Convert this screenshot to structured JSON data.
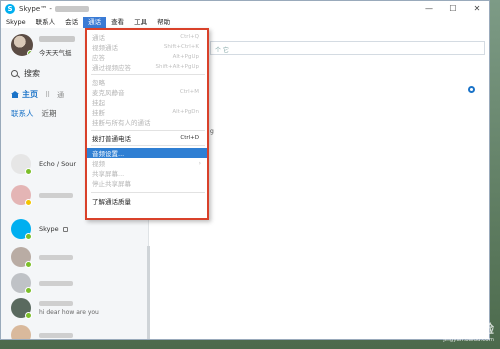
{
  "window": {
    "title": "Skype™ -"
  },
  "menubar": [
    "Skype",
    "联系人",
    "会话",
    "通话",
    "查看",
    "工具",
    "帮助"
  ],
  "profile": {
    "mood": "今天天气挺"
  },
  "search": {
    "label": "搜索"
  },
  "nav": {
    "home": "主页",
    "call_prefix": "通"
  },
  "tabs": [
    "联系人",
    "近期"
  ],
  "contacts": [
    {
      "name": "Echo / Sour",
      "status": "online"
    },
    {
      "name": "",
      "status": "away"
    },
    {
      "name": "Skype",
      "status": "online"
    },
    {
      "name": "",
      "status": "online"
    },
    {
      "name": "",
      "status": "online"
    },
    {
      "name": "",
      "status": "online",
      "sub": "hi dear how are you"
    },
    {
      "name": "",
      "status": "online"
    }
  ],
  "right": {
    "input_placeholder": "个 它",
    "stray_text": "g"
  },
  "dropdown": {
    "items": [
      {
        "label": "通话",
        "shortcut": "Ctrl+Q",
        "enabled": false
      },
      {
        "label": "视频通话",
        "shortcut": "Shift+Ctrl+K",
        "enabled": false
      },
      {
        "label": "应答",
        "shortcut": "Alt+PgUp",
        "enabled": false
      },
      {
        "label": "通过视频应答",
        "shortcut": "Shift+Alt+PgUp",
        "enabled": false
      },
      {
        "label": "忽略",
        "shortcut": "",
        "enabled": false
      },
      {
        "label": "麦克风静音",
        "shortcut": "Ctrl+M",
        "enabled": false
      },
      {
        "label": "挂起",
        "shortcut": "",
        "enabled": false
      },
      {
        "label": "挂断",
        "shortcut": "Alt+PgDn",
        "enabled": false
      },
      {
        "label": "挂断与所有人的通话",
        "shortcut": "",
        "enabled": false
      },
      {
        "label": "拨打普通电话",
        "shortcut": "Ctrl+D",
        "enabled": true
      },
      {
        "label": "音频设置...",
        "shortcut": "",
        "enabled": true,
        "highlight": true
      },
      {
        "label": "视频",
        "shortcut": "",
        "enabled": false,
        "submenu": true
      },
      {
        "label": "共享屏幕...",
        "shortcut": "",
        "enabled": false
      },
      {
        "label": "停止共享屏幕",
        "shortcut": "",
        "enabled": false
      },
      {
        "label": "了解通话质量",
        "shortcut": "",
        "enabled": true
      }
    ]
  },
  "watermark": {
    "logo": "Bai 经验",
    "url": "jingyan.baidu.com"
  },
  "colors": {
    "accent": "#2f7fd3",
    "menu_border": "#d9412a",
    "online": "#7cbf2a",
    "away": "#f4c400"
  }
}
